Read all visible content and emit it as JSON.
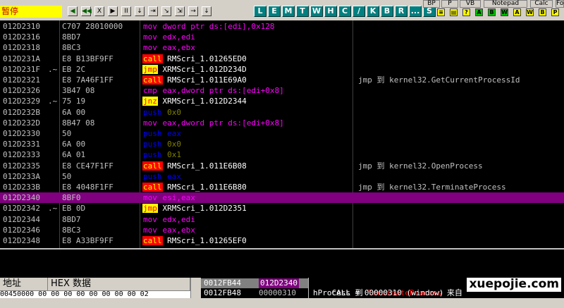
{
  "toolbar": {
    "status_label": "暂停",
    "debug_buttons": [
      "◀",
      "◀◀",
      "X",
      "▶",
      "II",
      "↓",
      "⇥",
      "↘",
      "⇲",
      "→",
      "↓"
    ],
    "letter_buttons": [
      "L",
      "E",
      "M",
      "T",
      "W",
      "H",
      "C",
      "/",
      "K",
      "B",
      "R",
      "...",
      "S"
    ],
    "plugin_buttons": [
      "BP",
      "P",
      "VB",
      "Notepad",
      "Calc",
      "Folder"
    ],
    "small_icons": [
      "≡",
      "▤",
      "?",
      "A",
      "B",
      "W",
      "A",
      "W",
      "B",
      "P"
    ]
  },
  "disasm": {
    "rows": [
      {
        "addr": "012D2310",
        "hex": "C707 28010000",
        "mn": "mov",
        "mnClass": "mov",
        "op": "dword ptr ds:[edi],0x128",
        "opClass": "mov",
        "comment": ""
      },
      {
        "addr": "012D2316",
        "hex": "8BD7",
        "mn": "mov",
        "mnClass": "mov",
        "op": "edx,edi",
        "opClass": "mov",
        "comment": ""
      },
      {
        "addr": "012D2318",
        "hex": "8BC3",
        "mn": "mov",
        "mnClass": "mov",
        "op": "eax,ebx",
        "opClass": "mov",
        "comment": ""
      },
      {
        "addr": "012D231A",
        "hex": "E8 B13BF9FF",
        "mn": "call",
        "mnClass": "call",
        "op": "RMScri_1.01265ED0",
        "opClass": "call",
        "comment": ""
      },
      {
        "addr": "012D231F",
        "mark": ".~",
        "hex": "EB 2C",
        "mn": "jmp",
        "mnClass": "jmp",
        "op": "XRMScri_1.012D234D",
        "opClass": "call",
        "comment": ""
      },
      {
        "addr": "012D2321",
        "hex": "E8 7A46F1FF",
        "mn": "call",
        "mnClass": "call",
        "op": "RMScri_1.011E69A0",
        "opClass": "call",
        "comment": "jmp 到 kernel32.GetCurrentProcessId"
      },
      {
        "addr": "012D2326",
        "hex": "3B47 08",
        "mn": "cmp",
        "mnClass": "cmp",
        "op": "eax,dword ptr ds:[edi+0x8]",
        "opClass": "mov",
        "comment": ""
      },
      {
        "addr": "012D2329",
        "mark": ".~",
        "hex": "75 19",
        "mn": "jnz",
        "mnClass": "jmp",
        "op": "XRMScri_1.012D2344",
        "opClass": "call",
        "comment": ""
      },
      {
        "addr": "012D232B",
        "hex": "6A 00",
        "mn": "push",
        "mnClass": "push",
        "op": "0x0",
        "opClass": "push-imm",
        "comment": ""
      },
      {
        "addr": "012D232D",
        "hex": "8B47 08",
        "mn": "mov",
        "mnClass": "mov",
        "op": "eax,dword ptr ds:[edi+0x8]",
        "opClass": "mov",
        "comment": ""
      },
      {
        "addr": "012D2330",
        "hex": "50",
        "mn": "push",
        "mnClass": "push",
        "op": "eax",
        "opClass": "push-reg",
        "comment": ""
      },
      {
        "addr": "012D2331",
        "hex": "6A 00",
        "mn": "push",
        "mnClass": "push",
        "op": "0x0",
        "opClass": "push-imm",
        "comment": ""
      },
      {
        "addr": "012D2333",
        "hex": "6A 01",
        "mn": "push",
        "mnClass": "push",
        "op": "0x1",
        "opClass": "push-imm",
        "comment": ""
      },
      {
        "addr": "012D2335",
        "hex": "E8 CE47F1FF",
        "mn": "call",
        "mnClass": "call",
        "op": "RMScri_1.011E6B08",
        "opClass": "call",
        "comment": "jmp 到 kernel32.OpenProcess"
      },
      {
        "addr": "012D233A",
        "hex": "50",
        "mn": "push",
        "mnClass": "push",
        "op": "eax",
        "opClass": "push-reg",
        "comment": ""
      },
      {
        "addr": "012D233B",
        "hex": "E8 4048F1FF",
        "mn": "call",
        "mnClass": "call",
        "op": "RMScri_1.011E6B80",
        "opClass": "call",
        "comment": "jmp 到 kernel32.TerminateProcess"
      },
      {
        "addr": "012D2340",
        "hex": "8BF0",
        "mn": "mov",
        "mnClass": "mov",
        "op": "esi,eax",
        "opClass": "mov",
        "comment": "",
        "selected": true
      },
      {
        "addr": "012D2342",
        "mark": ".~",
        "hex": "EB 0D",
        "mn": "jmp",
        "mnClass": "jmp",
        "op": "XRMScri_1.012D2351",
        "opClass": "call",
        "comment": ""
      },
      {
        "addr": "012D2344",
        "hex": "8BD7",
        "mn": "mov",
        "mnClass": "mov",
        "op": "edx,edi",
        "opClass": "mov",
        "comment": ""
      },
      {
        "addr": "012D2346",
        "hex": "8BC3",
        "mn": "mov",
        "mnClass": "mov",
        "op": "eax,ebx",
        "opClass": "mov",
        "comment": ""
      },
      {
        "addr": "012D2348",
        "hex": "E8 A33BF9FF",
        "mn": "call",
        "mnClass": "call",
        "op": "RMScri_1.01265EF0",
        "opClass": "call",
        "comment": ""
      }
    ]
  },
  "dump": {
    "header_address": "地址",
    "header_hex": "HEX 数据",
    "row_text": "00450000 00 00 00 00 00 00 00 00 02"
  },
  "stack": {
    "rows": [
      {
        "addr": "0012FB44",
        "value": "012D2340",
        "current": true
      },
      {
        "addr": "0012FB48",
        "value": "00000310",
        "current": false
      }
    ]
  },
  "stack_comment": {
    "line1_prefix": "CALL 到 ",
    "line1_func": "TerminateProcess",
    "line1_suffix": " 来自",
    "line2": "hProcess = 00000310 (window)"
  },
  "watermark": "xuepojie.com",
  "colors": {
    "selected_row": "#800080",
    "call_bg": "#ff0000",
    "jmp_bg": "#ffff00",
    "mov_fg": "#ff00ff",
    "push_fg": "#0000ff"
  }
}
